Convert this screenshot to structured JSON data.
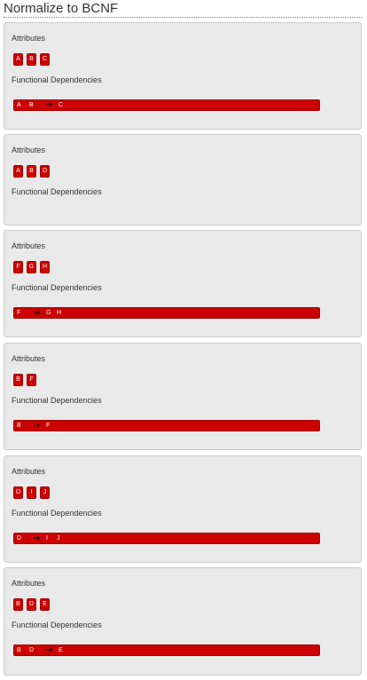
{
  "title": "Normalize to BCNF",
  "labels": {
    "attributes": "Attributes",
    "functional_dependencies": "Functional Dependencies",
    "arrow_icon": "arrow-right-icon",
    "arrow_glyph": "➔"
  },
  "colors": {
    "chip": "#cc0000",
    "panel": "#e9e9e9"
  },
  "relations": [
    {
      "attributes": [
        "A",
        "B",
        "C"
      ],
      "fds": [
        {
          "lhs": [
            "A",
            "B"
          ],
          "rhs": [
            "C"
          ]
        }
      ]
    },
    {
      "attributes": [
        "A",
        "B",
        "D"
      ],
      "fds": []
    },
    {
      "attributes": [
        "F",
        "G",
        "H"
      ],
      "fds": [
        {
          "lhs": [
            "F"
          ],
          "rhs": [
            "G",
            "H"
          ]
        }
      ]
    },
    {
      "attributes": [
        "B",
        "F"
      ],
      "fds": [
        {
          "lhs": [
            "B"
          ],
          "rhs": [
            "F"
          ]
        }
      ]
    },
    {
      "attributes": [
        "D",
        "I",
        "J"
      ],
      "fds": [
        {
          "lhs": [
            "D"
          ],
          "rhs": [
            "I",
            "J"
          ]
        }
      ]
    },
    {
      "attributes": [
        "B",
        "D",
        "E"
      ],
      "fds": [
        {
          "lhs": [
            "B",
            "D"
          ],
          "rhs": [
            "E"
          ]
        }
      ]
    }
  ]
}
